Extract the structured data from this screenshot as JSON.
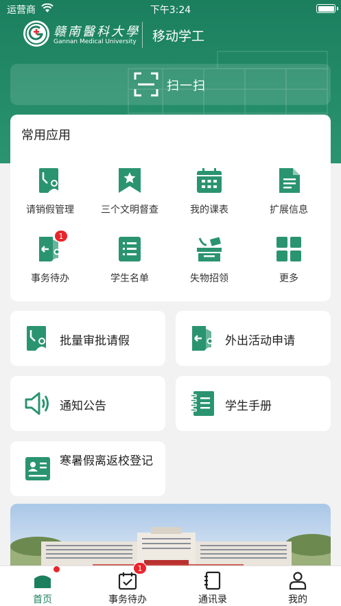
{
  "status_bar": {
    "carrier": "运营商",
    "time": "下午3:24"
  },
  "header": {
    "university_name_cn": "赣南醫科大學",
    "university_name_en": "Gannan Medical University",
    "app_name": "移动学工"
  },
  "scan": {
    "label": "扫一扫"
  },
  "common_apps": {
    "title": "常用应用",
    "items": [
      {
        "label": "请销假管理",
        "icon": "leave-icon"
      },
      {
        "label": "三个文明督查",
        "icon": "bookmark-star-icon"
      },
      {
        "label": "我的课表",
        "icon": "calendar-icon"
      },
      {
        "label": "扩展信息",
        "icon": "document-icon"
      },
      {
        "label": "事务待办",
        "icon": "door-exit-icon",
        "badge": "1"
      },
      {
        "label": "学生名单",
        "icon": "list-icon"
      },
      {
        "label": "失物招领",
        "icon": "lost-found-icon"
      },
      {
        "label": "更多",
        "icon": "grid-icon"
      }
    ]
  },
  "tiles": [
    {
      "label": "批量审批请假",
      "icon": "leave-icon"
    },
    {
      "label": "外出活动申请",
      "icon": "door-exit-icon"
    },
    {
      "label": "通知公告",
      "icon": "speaker-icon"
    },
    {
      "label": "学生手册",
      "icon": "notebook-icon"
    },
    {
      "label": "寒暑假离返校登记",
      "icon": "id-card-icon"
    }
  ],
  "tabbar": {
    "items": [
      {
        "label": "首页",
        "active": true,
        "dot": true
      },
      {
        "label": "事务待办",
        "badge": "1"
      },
      {
        "label": "通讯录"
      },
      {
        "label": "我的"
      }
    ]
  },
  "colors": {
    "primary": "#1b7f5e",
    "icon_green": "#2a9470",
    "badge_red": "#e8252b"
  }
}
